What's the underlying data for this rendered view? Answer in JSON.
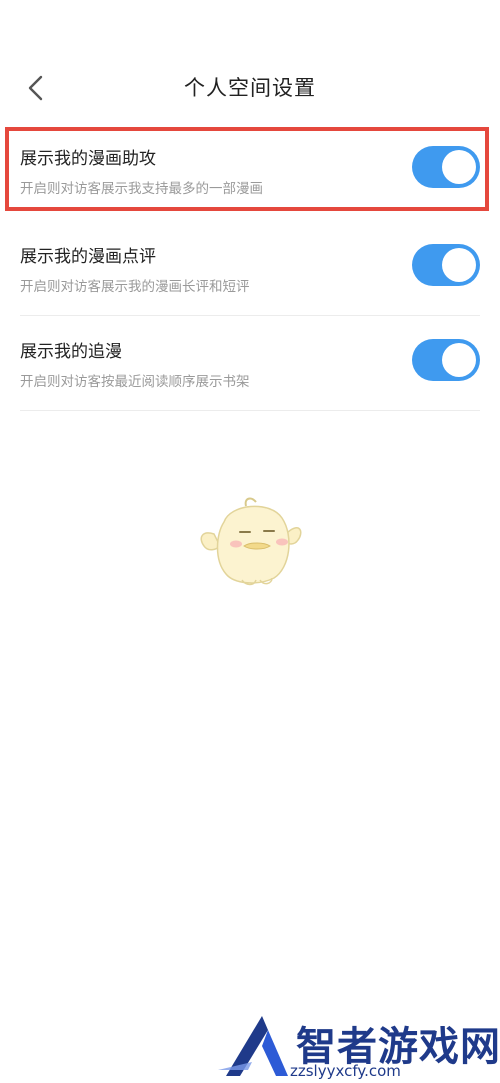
{
  "header": {
    "title": "个人空间设置",
    "back_icon": "chevron-left-icon"
  },
  "settings": [
    {
      "title": "展示我的漫画助攻",
      "description": "开启则对访客展示我支持最多的一部漫画",
      "enabled": true
    },
    {
      "title": "展示我的漫画点评",
      "description": "开启则对访客展示我的漫画长评和短评",
      "enabled": true
    },
    {
      "title": "展示我的追漫",
      "description": "开启则对访客按最近阅读顺序展示书架",
      "enabled": true
    }
  ],
  "colors": {
    "toggle_on": "#3f9aef",
    "highlight": "#e5483d",
    "text_primary": "#222222",
    "text_secondary": "#9a9a9a"
  },
  "watermark": {
    "brand": "智者游戏网",
    "url": "zzslyyxcfy.com"
  }
}
